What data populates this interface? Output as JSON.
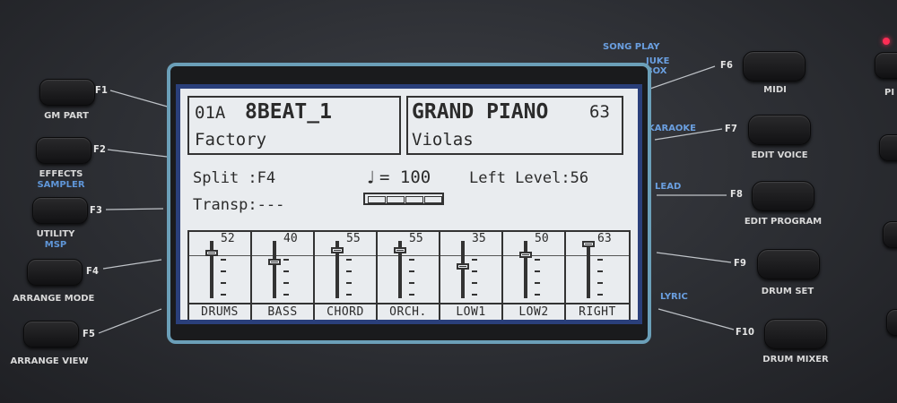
{
  "left_keys": [
    {
      "f": "F1",
      "label": "GM PART",
      "label2": ""
    },
    {
      "f": "F2",
      "label": "EFFECTS",
      "label2": "SAMPLER"
    },
    {
      "f": "F3",
      "label": "UTILITY",
      "label2": "MSP"
    },
    {
      "f": "F4",
      "label": "ARRANGE MODE",
      "label2": ""
    },
    {
      "f": "F5",
      "label": "ARRANGE VIEW",
      "label2": ""
    }
  ],
  "right_keys": [
    {
      "f": "F6",
      "label": "MIDI",
      "mode": "JUKE BOX"
    },
    {
      "f": "F7",
      "label": "EDIT VOICE",
      "mode": "KARAOKE"
    },
    {
      "f": "F8",
      "label": "EDIT PROGRAM",
      "mode": "LEAD"
    },
    {
      "f": "F9",
      "label": "DRUM SET",
      "mode": ""
    },
    {
      "f": "F10",
      "label": "DRUM MIXER",
      "mode": "LYRIC"
    }
  ],
  "song_play": "SONG PLAY",
  "far_right_label": "PI",
  "lcd": {
    "style_number": "01A",
    "style_name": "8BEAT_1",
    "style_bank": "Factory",
    "voice_name": "GRAND PIANO",
    "voice_number": "63",
    "voice_sub": "Violas",
    "split": "Split :F4",
    "tempo_symbol": "♩",
    "tempo": "= 100",
    "left_level": "Left Level:56",
    "transp": "Transp:---"
  },
  "mixer": [
    {
      "name": "DRUMS",
      "level": 52,
      "display": "52"
    },
    {
      "name": "BASS",
      "level": 40,
      "display": "40"
    },
    {
      "name": "CHORD",
      "level": 55,
      "display": "55"
    },
    {
      "name": "ORCH.",
      "level": 55,
      "display": "55"
    },
    {
      "name": "LOW1",
      "level": 35,
      "display": "35"
    },
    {
      "name": "LOW2",
      "level": 50,
      "display": "50"
    },
    {
      "name": "RIGHT",
      "level": 63,
      "display": "63"
    }
  ]
}
